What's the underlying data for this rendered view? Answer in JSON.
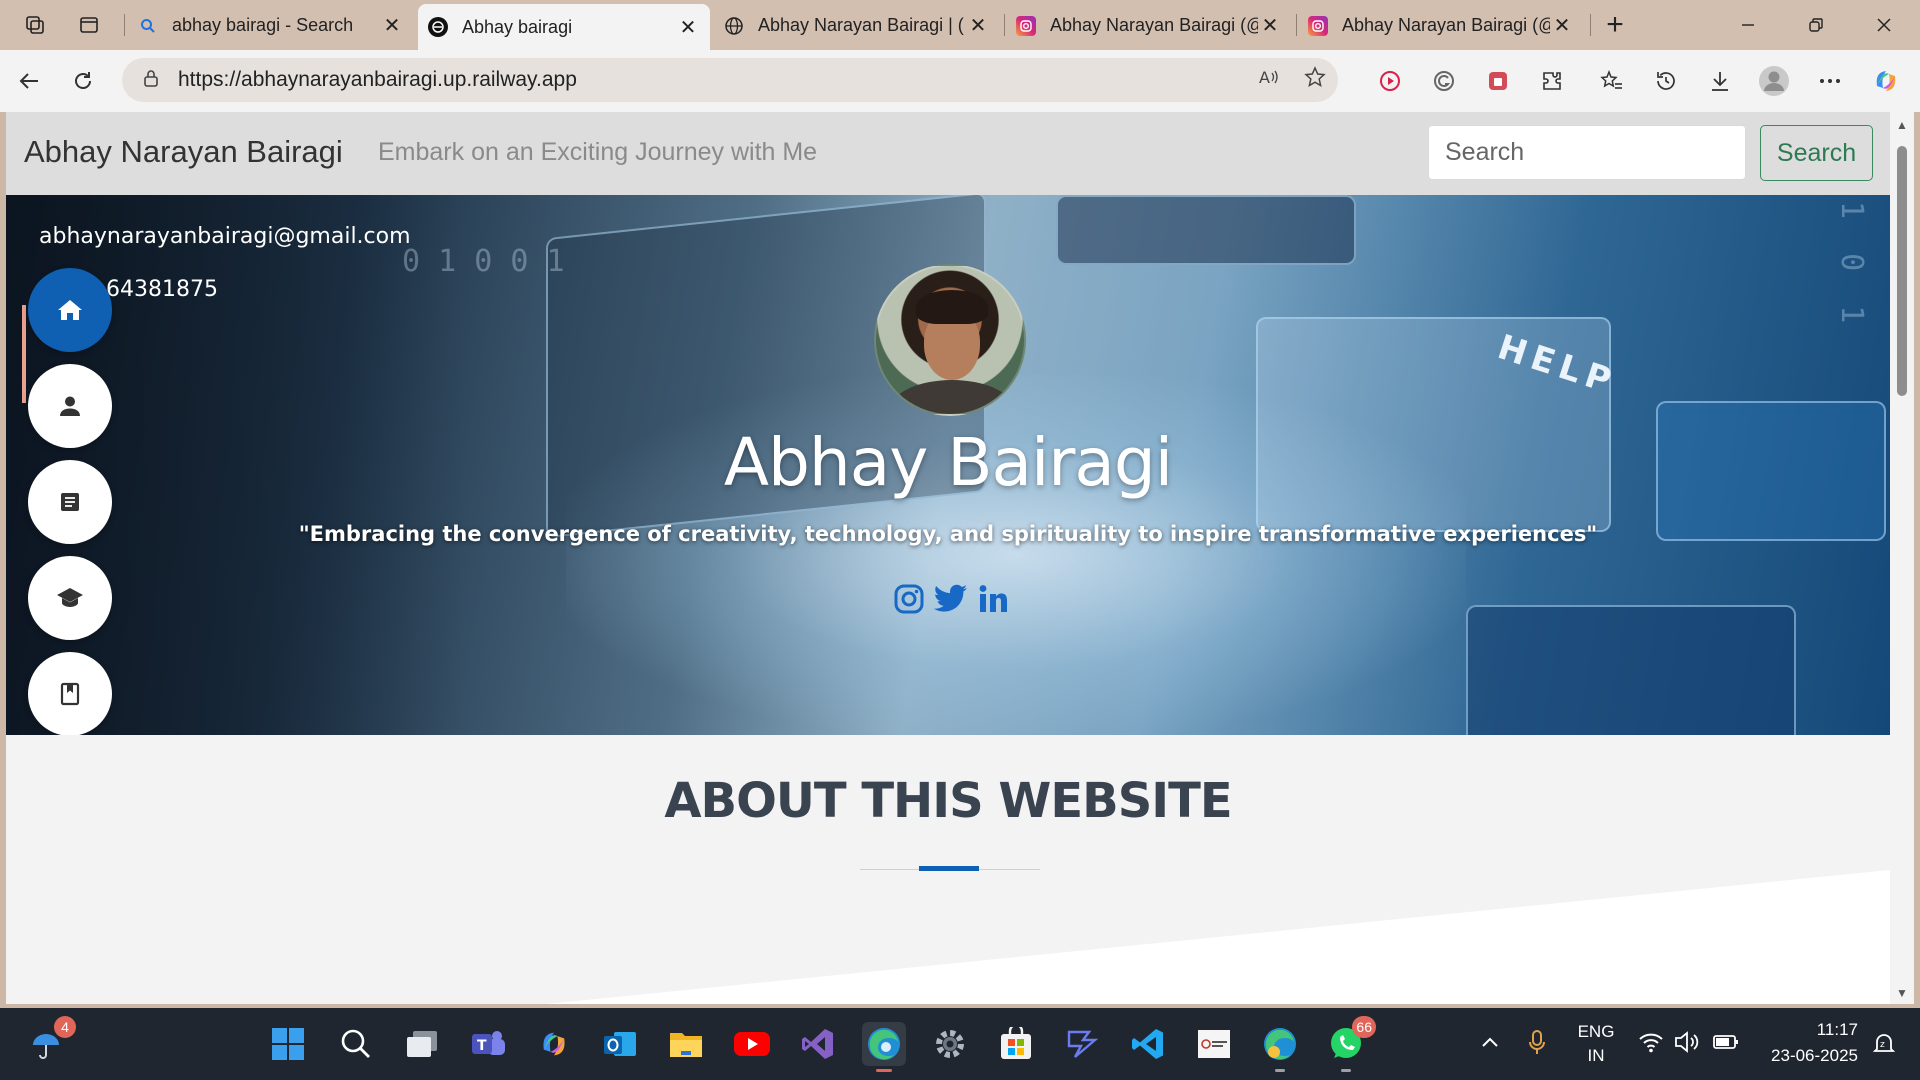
{
  "browser": {
    "tabs": [
      {
        "title": "abhay bairagi - Search",
        "icon": "search-icon",
        "active": false
      },
      {
        "title": "Abhay bairagi",
        "icon": "site-logo-icon",
        "active": true
      },
      {
        "title": "Abhay Narayan Bairagi | (",
        "icon": "globe-icon",
        "active": false
      },
      {
        "title": "Abhay Narayan Bairagi (@",
        "icon": "instagram-icon",
        "active": false
      },
      {
        "title": "Abhay Narayan Bairagi (@",
        "icon": "instagram-icon",
        "active": false
      }
    ],
    "url": "https://abhaynarayanbairagi.up.railway.app",
    "new_tab_glyph": "+",
    "close_glyph": "✕"
  },
  "site": {
    "brand": "Abhay Narayan Bairagi",
    "tagline": "Embark on an Exciting Journey with Me",
    "search_placeholder": "Search",
    "search_button": "Search",
    "contact": {
      "email": "abhaynarayanbairagi@gmail.com",
      "phone": "64381875"
    },
    "hero": {
      "name": "Abhay Bairagi",
      "quote": "\"Embracing the convergence of creativity, technology, and spirituality to inspire transformative experiences\"",
      "background_digits_left": "0 1 0 0 1",
      "background_digits_right": "1 0 1",
      "background_help_text": "HELP",
      "socials": [
        "instagram-icon",
        "twitter-icon",
        "linkedin-icon"
      ]
    },
    "side_menu": [
      "home-icon",
      "user-icon",
      "document-icon",
      "graduation-cap-icon",
      "book-icon"
    ],
    "about_title": "ABOUT THIS WEBSITE"
  },
  "taskbar": {
    "weather_badge": "4",
    "whatsapp_badge": "66",
    "language": "ENG",
    "region": "IN",
    "time": "11:17",
    "date": "23-06-2025"
  },
  "colors": {
    "accent_blue": "#0f5fb3",
    "search_green": "#2d7a53",
    "contact_bar": "#e9a08d",
    "social_blue": "#1769c5"
  }
}
